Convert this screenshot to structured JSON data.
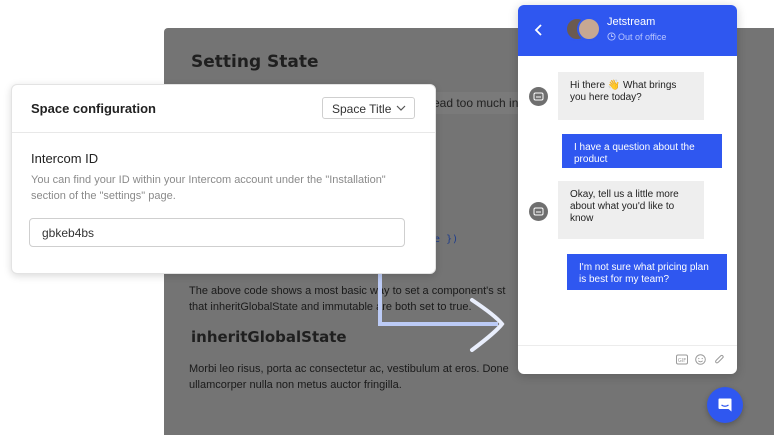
{
  "doc": {
    "heading": "Setting State",
    "peek_text": "read too much in",
    "code_tail": "rue })",
    "para1": "The above code shows a most basic way to set a component's st that inheritGlobalState and immutable are both set to true.",
    "heading2": "inheritGlobalState",
    "para2": "Morbi leo risus, porta ac consectetur ac, vestibulum at eros. Done ullamcorper nulla non metus auctor fringilla."
  },
  "config": {
    "title": "Space configuration",
    "space_select": "Space Title",
    "id_label": "Intercom ID",
    "id_help": "You can find your ID within your Intercom account under the \"Installation\" section of the \"settings\" page.",
    "id_value": "gbkeb4bs"
  },
  "chat": {
    "name": "Jetstream",
    "status": "Out of office",
    "messages": [
      {
        "from": "bot",
        "text": "Hi there 👋 What brings you here today?"
      },
      {
        "from": "user",
        "text": "I have a question about the product"
      },
      {
        "from": "bot",
        "text": "Okay, tell us a little more about what you'd like to know"
      },
      {
        "from": "user",
        "text": "I'm not sure what pricing plan is best for my team?"
      }
    ],
    "footer_icons": [
      "gif-icon",
      "emoji-icon",
      "attachment-icon"
    ]
  },
  "colors": {
    "accent": "#2f57f0",
    "doc_bg": "#747474"
  }
}
